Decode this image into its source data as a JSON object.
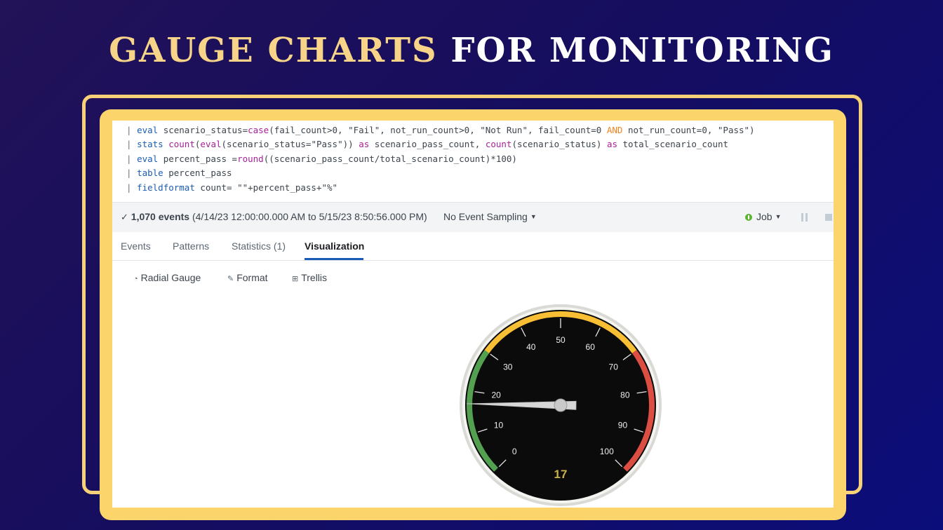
{
  "title": {
    "accent": "GAUGE CHARTS",
    "rest": "FOR MONITORING"
  },
  "query": {
    "line1": [
      {
        "t": "| ",
        "c": "pipe"
      },
      {
        "t": "eval",
        "c": "kw"
      },
      {
        "t": " scenario_status=",
        "c": ""
      },
      {
        "t": "case",
        "c": "fn"
      },
      {
        "t": "(fail_count>0, \"Fail\", not_run_count>0, \"Not Run\", fail_count=0 ",
        "c": ""
      },
      {
        "t": "AND",
        "c": "op"
      },
      {
        "t": " not_run_count=0, \"Pass\")",
        "c": ""
      }
    ],
    "line2": [
      {
        "t": "| ",
        "c": "pipe"
      },
      {
        "t": "stats",
        "c": "kw"
      },
      {
        "t": " ",
        "c": ""
      },
      {
        "t": "count",
        "c": "fn"
      },
      {
        "t": "(",
        "c": ""
      },
      {
        "t": "eval",
        "c": "fn"
      },
      {
        "t": "(scenario_status=\"Pass\")) ",
        "c": ""
      },
      {
        "t": "as",
        "c": "fn"
      },
      {
        "t": " scenario_pass_count, ",
        "c": ""
      },
      {
        "t": "count",
        "c": "fn"
      },
      {
        "t": "(scenario_status) ",
        "c": ""
      },
      {
        "t": "as",
        "c": "fn"
      },
      {
        "t": " total_scenario_count",
        "c": ""
      }
    ],
    "line3": [
      {
        "t": "| ",
        "c": "pipe"
      },
      {
        "t": "eval",
        "c": "kw"
      },
      {
        "t": " percent_pass =",
        "c": ""
      },
      {
        "t": "round",
        "c": "fn"
      },
      {
        "t": "((scenario_pass_count/total_scenario_count)*100)",
        "c": ""
      }
    ],
    "line4": [
      {
        "t": "| ",
        "c": "pipe"
      },
      {
        "t": "table",
        "c": "kw"
      },
      {
        "t": " percent_pass",
        "c": ""
      }
    ],
    "line5": [
      {
        "t": "| ",
        "c": "pipe"
      },
      {
        "t": "fieldformat",
        "c": "kw"
      },
      {
        "t": " count= \"\"+percent_pass+\"%\"",
        "c": ""
      }
    ]
  },
  "status": {
    "check": "✓",
    "events_count": "1,070 events",
    "time_range": "(4/14/23 12:00:00.000 AM to 5/15/23 8:50:56.000 PM)",
    "sampling": "No Event Sampling",
    "job": "Job"
  },
  "tabs": [
    {
      "label": "Events"
    },
    {
      "label": "Patterns"
    },
    {
      "label": "Statistics (1)"
    },
    {
      "label": "Visualization"
    }
  ],
  "viz_toolbar": {
    "gauge_type": "Radial Gauge",
    "format": "Format",
    "trellis": "Trellis"
  },
  "gauge": {
    "value": 17,
    "display_value": "17",
    "min": 0,
    "max": 100,
    "ticks": [
      "0",
      "10",
      "20",
      "30",
      "40",
      "50",
      "60",
      "70",
      "80",
      "90",
      "100"
    ],
    "ranges": [
      {
        "from": 0,
        "to": 30,
        "color": "#53a051"
      },
      {
        "from": 30,
        "to": 70,
        "color": "#f8be34"
      },
      {
        "from": 70,
        "to": 100,
        "color": "#dc4e41"
      }
    ],
    "value_color": "#c9b04c"
  }
}
